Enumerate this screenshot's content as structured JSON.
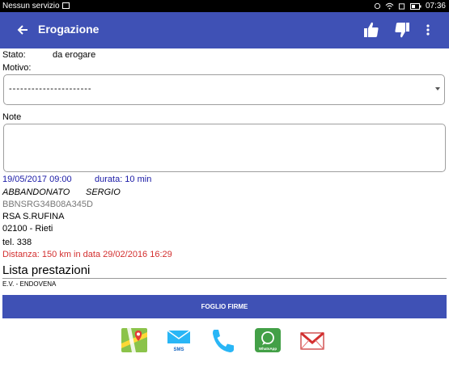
{
  "status_bar": {
    "carrier": "Nessun servizio",
    "time": "07:36"
  },
  "app_bar": {
    "title": "Erogazione",
    "icons": [
      "back-arrow-icon",
      "thumbs-up-icon",
      "thumbs-down-icon",
      "more-vert-icon"
    ]
  },
  "form": {
    "stato_label": "Stato:",
    "stato_value": "da erogare",
    "motivo_label": "Motivo:",
    "motivo_selected": "----------------------",
    "note_label": "Note",
    "note_value": ""
  },
  "appointment": {
    "datetime": "19/05/2017 09:00",
    "duration": "durata: 10 min",
    "surname": "ABBANDONATO",
    "name": "SERGIO",
    "fiscal_code": "BBNSRG34B08A345D",
    "facility": "RSA S.RUFINA",
    "address": "02100 - Rieti",
    "phone": "tel. 338",
    "distance": "Distanza: 150 km  in data 29/02/2016 16:29"
  },
  "services": {
    "title": "Lista prestazioni",
    "items": [
      "E.V. - ENDOVENA"
    ]
  },
  "signature_button": "FOGLIO FIRME",
  "share_bar": {
    "sms_label": "SMS",
    "whatsapp_label": "WhatsApp"
  },
  "colors": {
    "primary": "#3f51b5",
    "blue_text": "#1a1aa6",
    "red_text": "#d32f2f"
  }
}
